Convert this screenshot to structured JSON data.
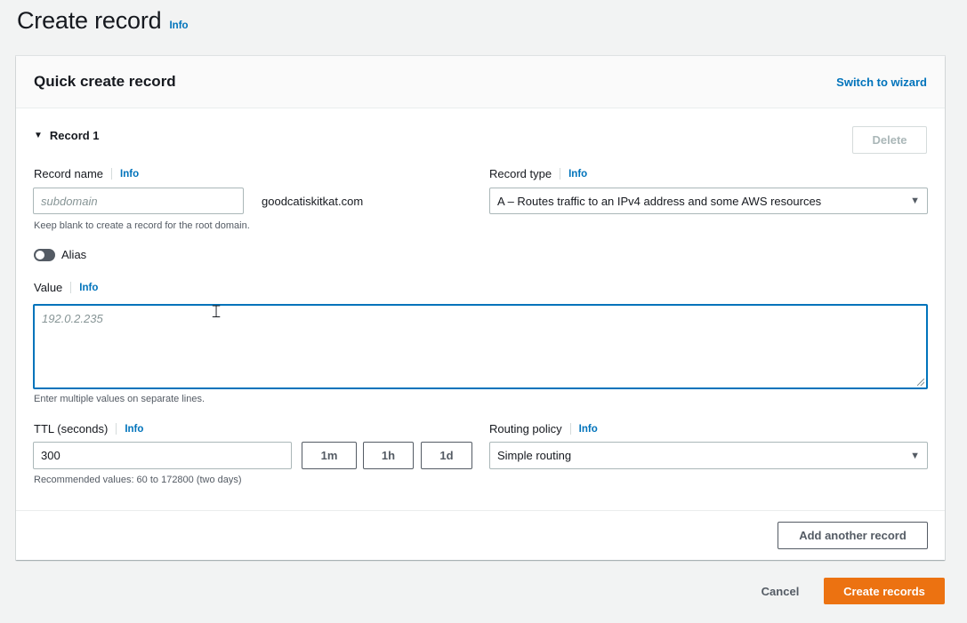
{
  "page": {
    "title": "Create record",
    "info": "Info"
  },
  "card": {
    "title": "Quick create record",
    "switch_link": "Switch to wizard",
    "record_label": "Record 1",
    "delete_label": "Delete"
  },
  "record_name": {
    "label": "Record name",
    "info": "Info",
    "placeholder": "subdomain",
    "domain_suffix": "goodcatiskitkat.com",
    "hint": "Keep blank to create a record for the root domain."
  },
  "record_type": {
    "label": "Record type",
    "info": "Info",
    "selected": "A – Routes traffic to an IPv4 address and some AWS resources"
  },
  "alias": {
    "label": "Alias",
    "enabled": false
  },
  "value": {
    "label": "Value",
    "info": "Info",
    "placeholder": "192.0.2.235",
    "hint": "Enter multiple values on separate lines."
  },
  "ttl": {
    "label": "TTL (seconds)",
    "info": "Info",
    "value": "300",
    "btn_1m": "1m",
    "btn_1h": "1h",
    "btn_1d": "1d",
    "hint": "Recommended values: 60 to 172800 (two days)"
  },
  "routing": {
    "label": "Routing policy",
    "info": "Info",
    "selected": "Simple routing"
  },
  "footer": {
    "add_another": "Add another record",
    "cancel": "Cancel",
    "create": "Create records"
  },
  "colors": {
    "link": "#0073bb",
    "primary": "#ec7211",
    "focus": "#0073bb"
  },
  "icons": {
    "expander": "caret-down-icon",
    "select": "caret-down-icon",
    "cursor": "text-cursor-icon"
  }
}
